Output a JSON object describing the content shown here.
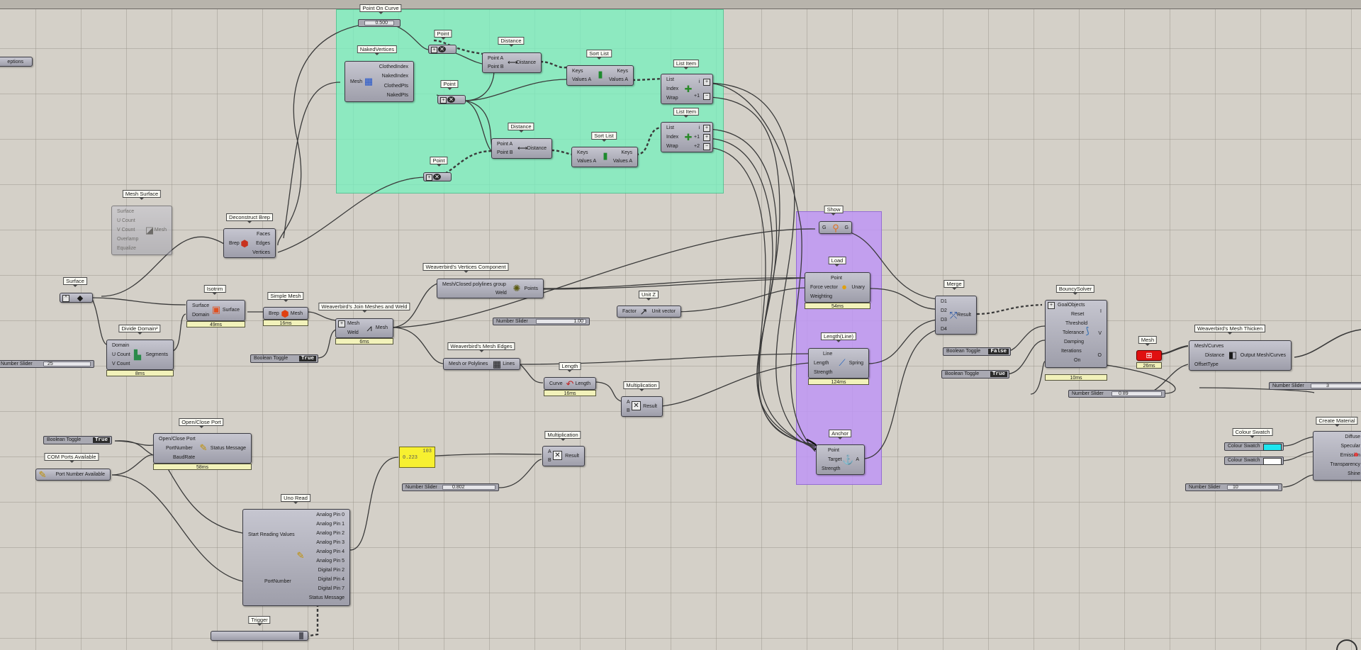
{
  "groups": {
    "green": "#78f0be",
    "purple": "#be96f5"
  },
  "components": {
    "left_tag": {
      "label": "eptions"
    },
    "point_on_curve": {
      "title": "Point On Curve",
      "value": "0.500"
    },
    "point_1": {
      "title": "Point"
    },
    "point_2": {
      "title": "Point"
    },
    "point_3": {
      "title": "Point"
    },
    "naked_vertices": {
      "title": "NakedVertices",
      "input": "Mesh",
      "outputs": [
        "ClothedIndex",
        "NakedIndex",
        "ClothedPts",
        "NakedPts"
      ]
    },
    "distance_1": {
      "title": "Distance",
      "inputs": [
        "Point A",
        "Point B"
      ],
      "output": "Distance"
    },
    "distance_2": {
      "title": "Distance",
      "inputs": [
        "Point A",
        "Point B"
      ],
      "output": "Distance"
    },
    "sort_list_1": {
      "title": "Sort List",
      "inputs": [
        "Keys",
        "Values A"
      ],
      "outputs": [
        "Keys",
        "Values A"
      ]
    },
    "sort_list_2": {
      "title": "Sort List",
      "inputs": [
        "Keys",
        "Values A"
      ],
      "outputs": [
        "Keys",
        "Values A"
      ]
    },
    "list_item_1": {
      "title": "List Item",
      "inputs": [
        "List",
        "Index",
        "Wrap"
      ],
      "outputs": [
        "i",
        "+1"
      ]
    },
    "list_item_2": {
      "title": "List Item",
      "inputs": [
        "List",
        "Index",
        "Wrap"
      ],
      "outputs": [
        "i",
        "+1",
        "+2"
      ]
    },
    "mesh_surface": {
      "title": "Mesh Surface",
      "inputs": [
        "Surface",
        "U Count",
        "V Count",
        "Overlamp",
        "Equalize"
      ],
      "output": "Mesh"
    },
    "deconstruct_brep": {
      "title": "Deconstruct Brep",
      "input": "Brep",
      "outputs": [
        "Faces",
        "Edges",
        "Vertices"
      ]
    },
    "surface": {
      "title": "Surface"
    },
    "isotrim": {
      "title": "Isotrim",
      "inputs": [
        "Surface",
        "Domain"
      ],
      "output": "Surface",
      "time": "49ms"
    },
    "simple_mesh": {
      "title": "Simple Mesh",
      "input": "Brep",
      "output": "Mesh",
      "time": "16ms"
    },
    "join_meshes": {
      "title": "Weaverbird's Join Meshes and Weld",
      "inputs": [
        "Mesh",
        "Weld"
      ],
      "output": "Mesh",
      "time": "6ms"
    },
    "vertices_component": {
      "title": "Weaverbird's Vertices Component",
      "inputs": [
        "Mesh/Closed polylines group",
        "Weld"
      ],
      "output": "Points"
    },
    "divide_domain": {
      "title": "Divide Domain²",
      "inputs": [
        "Domain",
        "U Count",
        "V Count"
      ],
      "output": "Segments",
      "time": "8ms"
    },
    "mesh_edges": {
      "title": "Weaverbird's Mesh Edges",
      "input": "Mesh or Polylines",
      "output": "Lines"
    },
    "length": {
      "title": "Length",
      "input": "Curve",
      "output": "Length",
      "time": "16ms"
    },
    "unit_z": {
      "title": "Unit Z",
      "input": "Factor",
      "output": "Unit vector"
    },
    "multiplication_1": {
      "title": "Multiplication",
      "inputs": [
        "A",
        "B"
      ],
      "output": "Result"
    },
    "multiplication_2": {
      "title": "Multiplication",
      "inputs": [
        "A",
        "B"
      ],
      "output": "Result"
    },
    "show": {
      "title": "Show",
      "input": "G",
      "output": "G"
    },
    "load": {
      "title": "Load",
      "inputs": [
        "Point",
        "Force vector",
        "Weighting"
      ],
      "output": "Unary",
      "time": "54ms"
    },
    "length_line": {
      "title": "Length(Line)",
      "inputs": [
        "Line",
        "Length",
        "Strength"
      ],
      "output": "Spring",
      "time": "124ms"
    },
    "anchor": {
      "title": "Anchor",
      "inputs": [
        "Point",
        "Target",
        "Strength"
      ],
      "output": "A"
    },
    "merge": {
      "title": "Merge",
      "inputs": [
        "D1",
        "D2",
        "D3",
        "D4"
      ],
      "output": "Result"
    },
    "bouncy_solver": {
      "title": "BouncySolver",
      "inputs": [
        "GoalObjects",
        "Reset",
        "Threshold",
        "Tolerance",
        "Damping",
        "Iterations",
        "On"
      ],
      "outputs": [
        "I",
        "V",
        "O"
      ],
      "time": "10ms"
    },
    "mesh_param": {
      "title": "Mesh",
      "time": "26ms"
    },
    "mesh_thicken": {
      "title": "Weaverbird's Mesh Thicken",
      "inputs": [
        "Mesh/Curves",
        "Distance",
        "OffsetType"
      ],
      "output": "Output Mesh/Curves"
    },
    "open_close_port": {
      "title": "Open/Close Port",
      "inputs": [
        "Open/Close Port",
        "PortNumber",
        "BaudRate"
      ],
      "output": "Status Message",
      "time": "58ms"
    },
    "com_ports": {
      "title": "COM Ports Available",
      "output": "Port Number Available"
    },
    "uno_read": {
      "title": "Uno Read",
      "inputs": [
        "Start Reading Values",
        "PortNumber"
      ],
      "outputs": [
        "Analog Pin 0",
        "Analog Pin 1",
        "Analog Pin 2",
        "Analog Pin 3",
        "Analog Pin 4",
        "Analog Pin 5",
        "Digital Pin 2",
        "Digital Pin 4",
        "Digital Pin 7",
        "Status Message"
      ]
    },
    "trigger": {
      "title": "Trigger"
    },
    "create_material": {
      "title": "Create Material",
      "inputs": [
        "Diffuse",
        "Specular",
        "Emission",
        "Transparency",
        "Shine"
      ]
    },
    "colour_swatch_1": {
      "title": "Colour Swatch",
      "label": "Colour Swatch",
      "color": "#1ee6f0"
    },
    "colour_swatch_2": {
      "label": "Colour Swatch",
      "color": "#ffffff"
    },
    "yellow_panel": {
      "line1": "103",
      "line2": "0.223"
    }
  },
  "sliders": {
    "s_25": {
      "label": "Number Slider",
      "value": "25"
    },
    "s_100": {
      "label": "Number Slider",
      "value": "1.00"
    },
    "s_0802": {
      "label": "Number Slider",
      "value": "0.802"
    },
    "s_089": {
      "label": "Number Slider",
      "value": "0.89"
    },
    "s_3": {
      "label": "Number Slider",
      "value": "3"
    },
    "s_10": {
      "label": "Number Slider",
      "value": "10"
    }
  },
  "toggles": {
    "t_join": {
      "label": "Boolean Toggle",
      "state": "True"
    },
    "t_reset": {
      "label": "Boolean Toggle",
      "state": "False"
    },
    "t_on": {
      "label": "Boolean Toggle",
      "state": "True"
    },
    "t_port": {
      "label": "Boolean Toggle",
      "state": "True"
    }
  }
}
